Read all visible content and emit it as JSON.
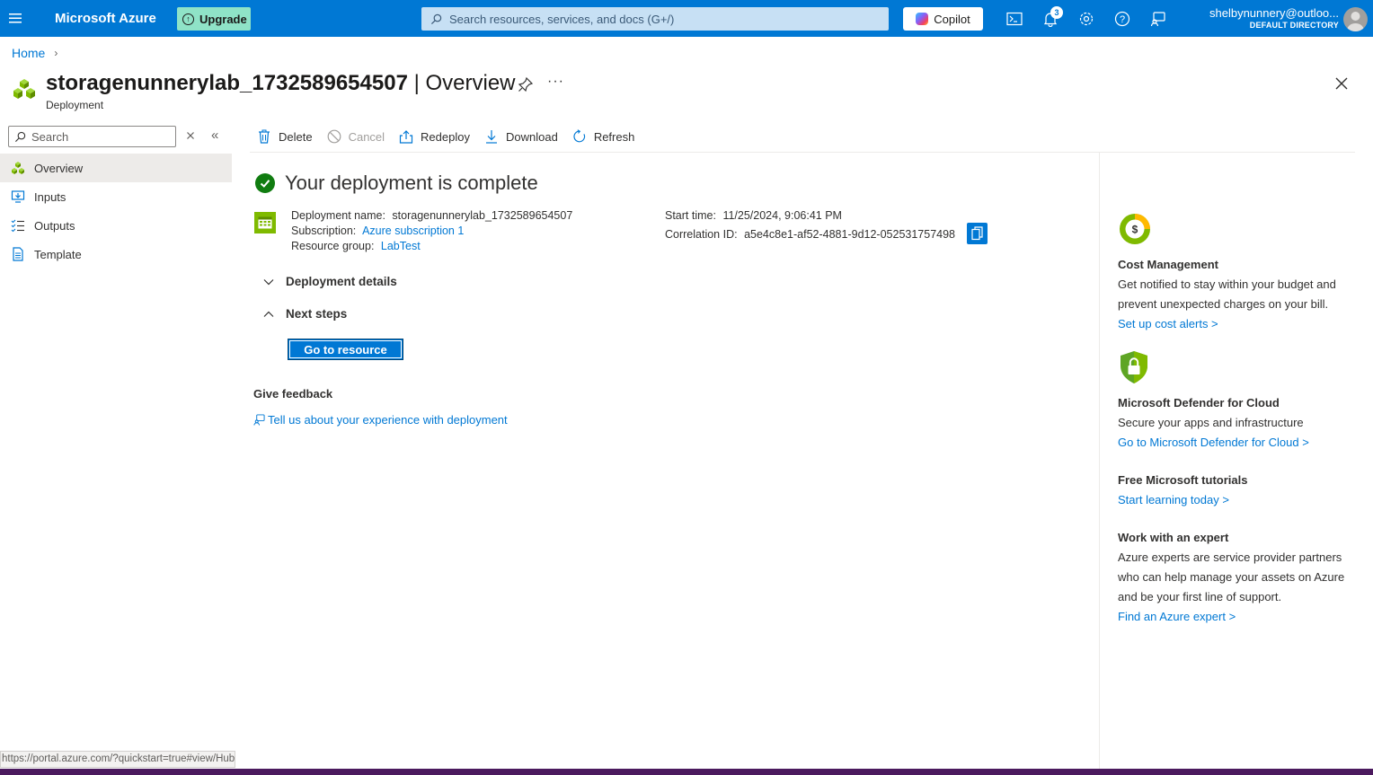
{
  "topbar": {
    "brand": "Microsoft Azure",
    "upgrade_label": "Upgrade",
    "search_placeholder": "Search resources, services, and docs (G+/)",
    "copilot_label": "Copilot",
    "notification_count": "3",
    "account_email": "shelbynunnery@outloo...",
    "account_directory": "DEFAULT DIRECTORY"
  },
  "breadcrumb": {
    "home": "Home"
  },
  "header": {
    "resource_name": "storagenunnerylab_1732589654507",
    "section": " | Overview",
    "resource_type": "Deployment"
  },
  "sidebar": {
    "search_placeholder": "Search",
    "items": [
      {
        "label": "Overview",
        "icon": "deployment-cubes-icon",
        "active": true
      },
      {
        "label": "Inputs",
        "icon": "inputs-icon"
      },
      {
        "label": "Outputs",
        "icon": "outputs-list-icon"
      },
      {
        "label": "Template",
        "icon": "template-document-icon"
      }
    ]
  },
  "toolbar": {
    "delete": "Delete",
    "cancel": "Cancel",
    "redeploy": "Redeploy",
    "download": "Download",
    "refresh": "Refresh"
  },
  "main": {
    "status_text": "Your deployment is complete",
    "deployment_name_label": "Deployment name:",
    "deployment_name": "storagenunnerylab_1732589654507",
    "subscription_label": "Subscription:",
    "subscription": "Azure subscription 1",
    "resource_group_label": "Resource group:",
    "resource_group": "LabTest",
    "start_time_label": "Start time:",
    "start_time": "11/25/2024, 9:06:41 PM",
    "correlation_label": "Correlation ID:",
    "correlation_id": "a5e4c8e1-af52-4881-9d12-052531757498",
    "deployment_details": "Deployment details",
    "next_steps": "Next steps",
    "go_to_resource": "Go to resource",
    "feedback_title": "Give feedback",
    "feedback_link": "Tell us about your experience with deployment"
  },
  "right_panel": {
    "cost": {
      "title": "Cost Management",
      "line1": "Get notified to stay within your budget and",
      "line2": "prevent unexpected charges on your bill.",
      "link": "Set up cost alerts >"
    },
    "defender": {
      "title": "Microsoft Defender for Cloud",
      "desc": "Secure your apps and infrastructure",
      "link": "Go to Microsoft Defender for Cloud >"
    },
    "tutorials": {
      "title": "Free Microsoft tutorials",
      "link": "Start learning today >"
    },
    "expert": {
      "title": "Work with an expert",
      "line1": "Azure experts are service provider partners",
      "line2": "who can help manage your assets on Azure",
      "line3": "and be your first line of support.",
      "link": "Find an Azure expert >"
    }
  },
  "status_url": "https://portal.azure.com/?quickstart=true#view/HubsExtension",
  "colors": {
    "accent": "#0078d4",
    "success": "#107c10",
    "brand_green": "#7fba00"
  }
}
